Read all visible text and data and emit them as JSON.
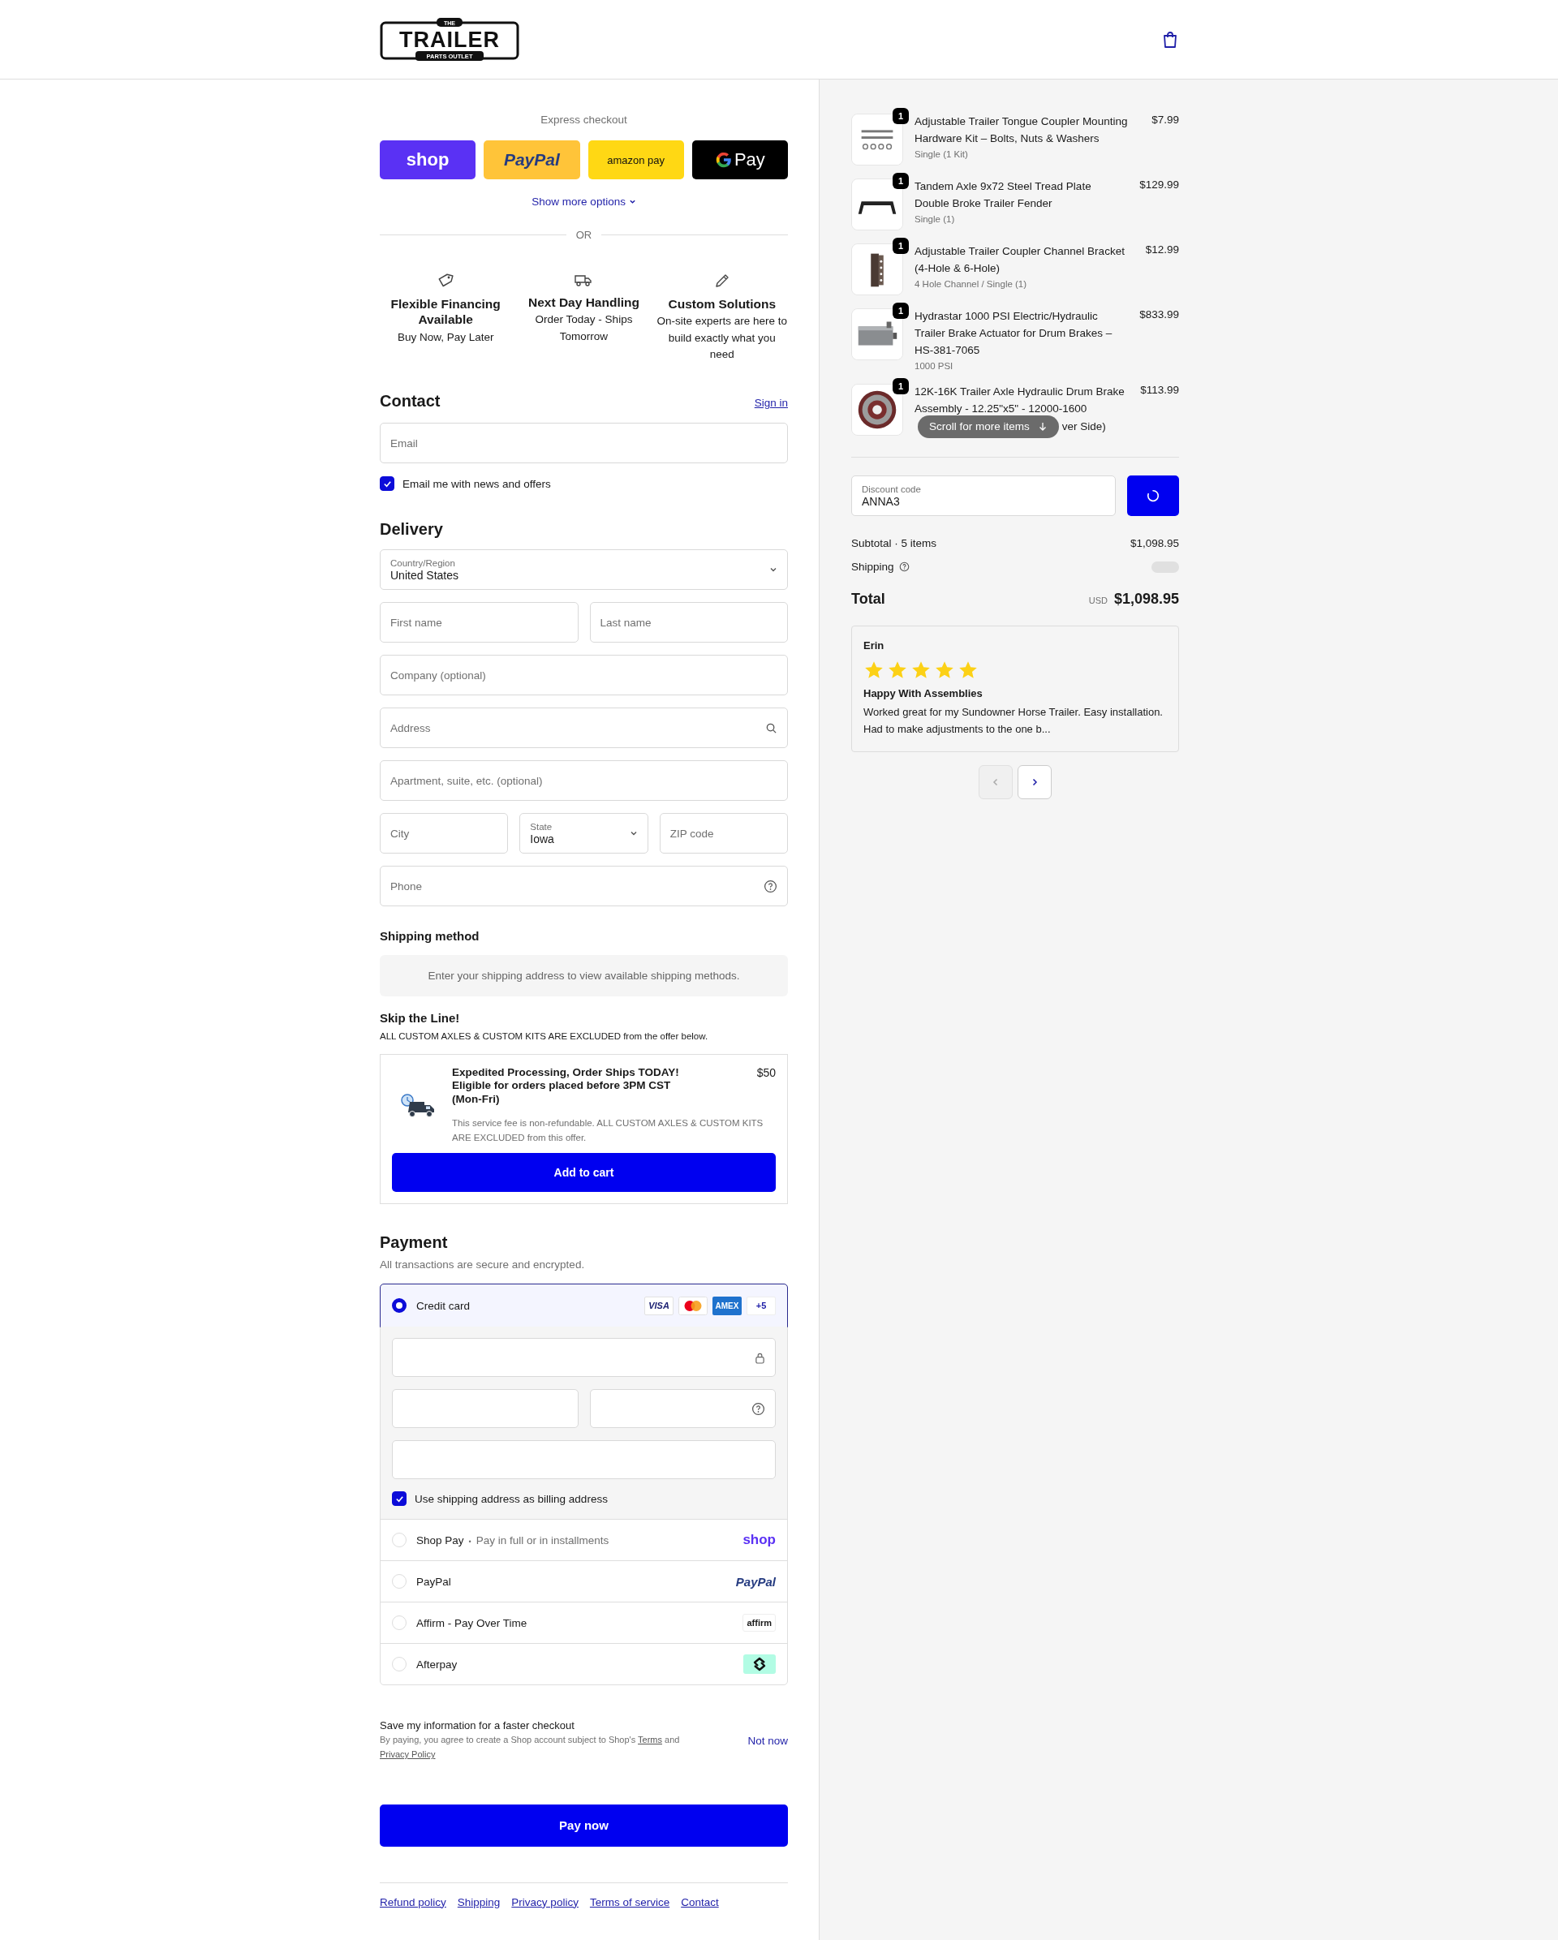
{
  "header": {
    "logo": {
      "top": "THE",
      "main": "TRAILER",
      "bottom": "PARTS OUTLET"
    }
  },
  "express": {
    "label": "Express checkout",
    "buttons": [
      {
        "kind": "shop",
        "label": "shop"
      },
      {
        "kind": "paypal",
        "label": "PayPal"
      },
      {
        "kind": "amazon",
        "label": "amazon pay"
      },
      {
        "kind": "gpay",
        "label": "Pay"
      }
    ],
    "more": "Show more options",
    "divider": "OR"
  },
  "features": [
    {
      "kind": "tag",
      "title": "Flexible Financing Available",
      "text": "Buy Now, Pay Later"
    },
    {
      "kind": "truck",
      "title": "Next Day Handling",
      "text": "Order Today - Ships Tomorrow"
    },
    {
      "kind": "pencil",
      "title": "Custom Solutions",
      "text": "On-site experts are here to build exactly what you need"
    }
  ],
  "contact": {
    "heading": "Contact",
    "sign_in": "Sign in",
    "email": {
      "placeholder": "Email"
    },
    "newsletter": {
      "label": "Email me with news and offers",
      "checked": true
    }
  },
  "delivery": {
    "heading": "Delivery",
    "rows": [
      [
        {
          "kind": "select",
          "label": "Country/Region",
          "value": "United States"
        }
      ],
      [
        {
          "kind": "input",
          "placeholder": "First name"
        },
        {
          "kind": "input",
          "placeholder": "Last name"
        }
      ],
      [
        {
          "kind": "input",
          "placeholder": "Company (optional)"
        }
      ],
      [
        {
          "kind": "search",
          "placeholder": "Address"
        }
      ],
      [
        {
          "kind": "input",
          "placeholder": "Apartment, suite, etc. (optional)"
        }
      ],
      [
        {
          "kind": "input",
          "placeholder": "City"
        },
        {
          "kind": "select",
          "label": "State",
          "value": "Iowa"
        },
        {
          "kind": "input",
          "placeholder": "ZIP code"
        }
      ],
      [
        {
          "kind": "help",
          "placeholder": "Phone"
        }
      ]
    ]
  },
  "shipping_method": {
    "heading": "Shipping method",
    "notice": "Enter your shipping address to view available shipping methods."
  },
  "upsell": {
    "heading": "Skip the Line!",
    "note": "ALL CUSTOM AXLES & CUSTOM KITS ARE EXCLUDED from the offer below.",
    "title": "Expedited Processing, Order Ships TODAY! Eligible for orders placed before 3PM CST (Mon-Fri)",
    "price": "$50",
    "fine_print": "This service fee is non-refundable. ALL CUSTOM AXLES & CUSTOM KITS ARE EXCLUDED from this offer.",
    "button": "Add to cart"
  },
  "payment": {
    "heading": "Payment",
    "sub": "All transactions are secure and encrypted.",
    "methods": [
      {
        "kind": "card",
        "label": "Credit card",
        "selected": true,
        "badges": [
          {
            "kind": "visa",
            "text": "VISA"
          },
          {
            "kind": "mastercard"
          },
          {
            "kind": "amex",
            "text": "AMEX"
          },
          {
            "kind": "more",
            "text": "+5"
          }
        ],
        "billing": {
          "label": "Use shipping address as billing address",
          "checked": true
        }
      },
      {
        "kind": "shop",
        "label": "Shop Pay",
        "separator": "•",
        "sublabel": "Pay in full or in installments",
        "logo": "shop",
        "selected": false
      },
      {
        "kind": "paypal",
        "label": "PayPal",
        "logo": "PayPal",
        "selected": false
      },
      {
        "kind": "affirm",
        "label": "Affirm - Pay Over Time",
        "logo": "affirm",
        "selected": false
      },
      {
        "kind": "afterpay",
        "label": "Afterpay",
        "selected": false
      }
    ]
  },
  "save": {
    "title": "Save my information for a faster checkout",
    "legal": [
      {
        "kind": "text",
        "text": "By paying, you agree to create a Shop account subject to Shop's "
      },
      {
        "kind": "link",
        "text": "Terms"
      },
      {
        "kind": "text",
        "text": " and "
      },
      {
        "kind": "link",
        "text": "Privacy Policy"
      }
    ],
    "not_now": "Not now"
  },
  "pay": "Pay now",
  "footer": [
    "Refund policy",
    "Shipping",
    "Privacy policy",
    "Terms of service",
    "Contact"
  ],
  "items": [
    {
      "kind": "bolts",
      "qty": "1",
      "title": "Adjustable Trailer Tongue Coupler Mounting Hardware Kit – Bolts, Nuts & Washers",
      "variant": "Single (1 Kit)",
      "price": "$7.99"
    },
    {
      "kind": "fender",
      "qty": "1",
      "title": "Tandem Axle 9x72 Steel Tread Plate Double Broke Trailer Fender",
      "variant": "Single (1)",
      "price": "$129.99"
    },
    {
      "kind": "bracket",
      "qty": "1",
      "title": "Adjustable Trailer Coupler Channel Bracket (4-Hole & 6-Hole)",
      "variant": "4 Hole Channel / Single (1)",
      "price": "$12.99"
    },
    {
      "kind": "actuator",
      "qty": "1",
      "title": "Hydrastar 1000 PSI Electric/Hydraulic Trailer Brake Actuator for Drum Brakes – HS-381-7065",
      "variant": "1000 PSI",
      "price": "$833.99"
    },
    {
      "kind": "drum",
      "qty": "1",
      "title": "12K-16K Trailer Axle Hydraulic Drum Brake Assembly - 12.25\"x5\" - 12000-1600",
      "title_end": "ver Side)",
      "price": "$113.99"
    }
  ],
  "scroll_hint": "Scroll for more items",
  "discount": {
    "label": "Discount code",
    "value": "ANNA3"
  },
  "summary": {
    "subtotal_label": "Subtotal · 5 items",
    "subtotal": "$1,098.95",
    "shipping_label": "Shipping",
    "total_label": "Total",
    "currency": "USD",
    "total": "$1,098.95"
  },
  "review": {
    "name": "Erin",
    "stars": 5,
    "title": "Happy With Assemblies",
    "body": "Worked great for my Sundowner Horse Trailer. Easy installation. Had to make adjustments to the one b..."
  },
  "pager": [
    {
      "kind": "prev",
      "disabled": true
    },
    {
      "kind": "next",
      "disabled": false
    }
  ]
}
